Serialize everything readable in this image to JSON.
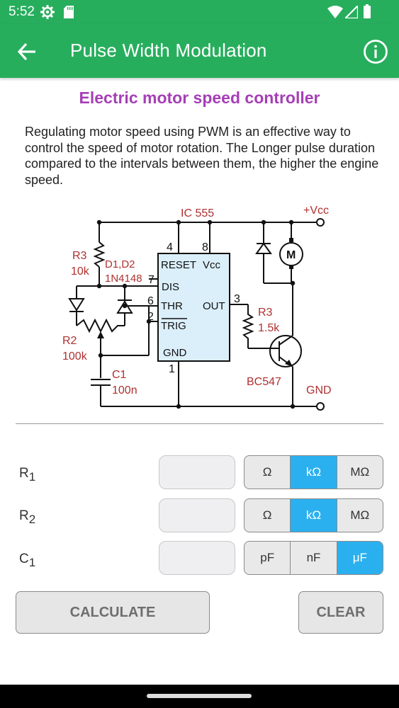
{
  "status_bar": {
    "time": "5:52"
  },
  "app_bar": {
    "title": "Pulse Width Modulation"
  },
  "heading": "Electric motor speed controller",
  "description": "Regulating motor speed using PWM is an effective way to control the speed of motor rotation. The Longer pulse duration compared to the intervals between them, the higher the engine speed.",
  "circuit": {
    "ic": "IC 555",
    "vcc": "+Vcc",
    "gnd": "GND",
    "r3_left": "R3",
    "r3_left_val": "10k",
    "diodes": "D1,D2",
    "diodes_part": "1N4148",
    "r2": "R2",
    "r2_val": "100k",
    "c1": "C1",
    "c1_val": "100n",
    "r3_right": "R3",
    "r3_right_val": "1.5k",
    "transistor": "BC547",
    "motor": "M",
    "pin_reset": "RESET",
    "pin_vcc": "Vcc",
    "pin_dis": "DIS",
    "pin_thr": "THR",
    "pin_out": "OUT",
    "pin_trig": "TRIG",
    "pin_gnd": "GND",
    "n4": "4",
    "n8": "8",
    "n7": "7",
    "n6": "6",
    "n2": "2",
    "n3": "3",
    "n1": "1"
  },
  "rows": [
    {
      "label": "R",
      "sub": "1",
      "value": "",
      "units": [
        "Ω",
        "kΩ",
        "MΩ"
      ],
      "selected": 1
    },
    {
      "label": "R",
      "sub": "2",
      "value": "",
      "units": [
        "Ω",
        "kΩ",
        "MΩ"
      ],
      "selected": 1
    },
    {
      "label": "C",
      "sub": "1",
      "value": "",
      "units": [
        "pF",
        "nF",
        "μF"
      ],
      "selected": 2
    }
  ],
  "buttons": {
    "calculate": "CALCULATE",
    "clear": "CLEAR"
  },
  "colors": {
    "primary": "#27ae5d",
    "accent": "#2bb0ef",
    "heading": "#a53fb6",
    "schematic_text": "#b03030",
    "ic_fill": "#dbeffa"
  }
}
